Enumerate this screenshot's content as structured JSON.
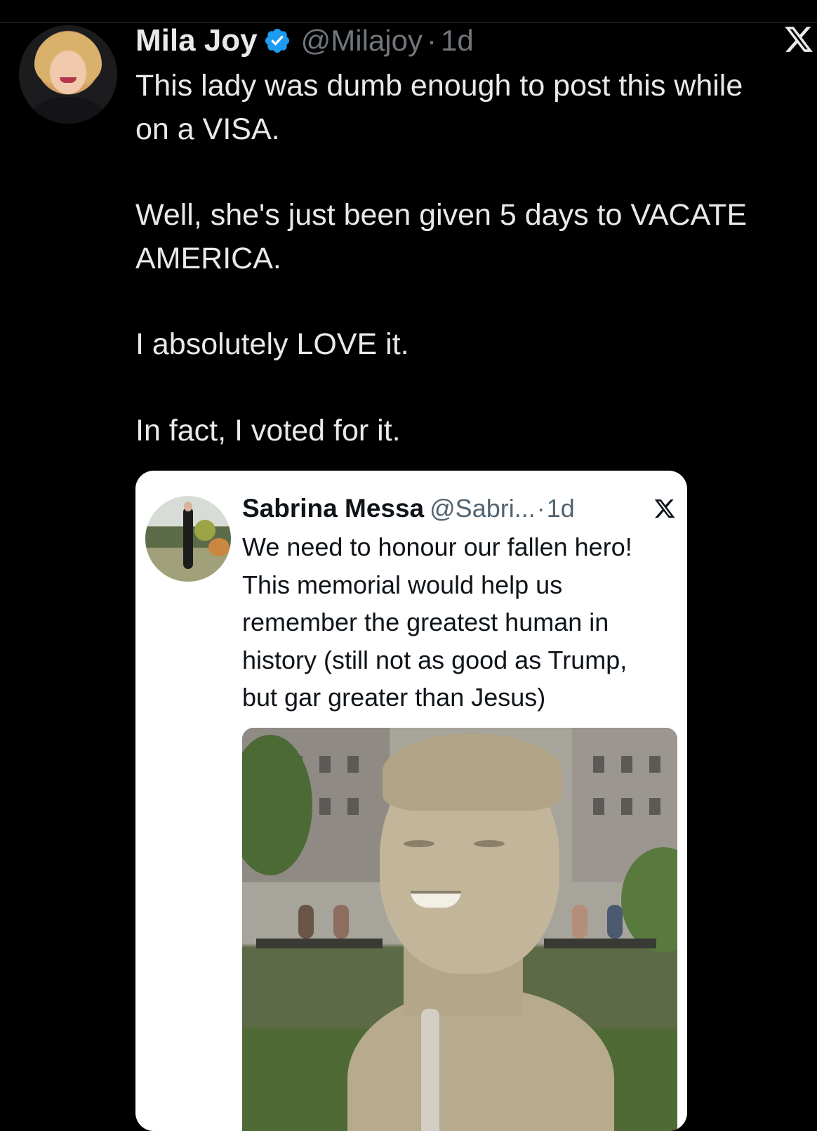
{
  "tweet": {
    "author_name": "Mila Joy",
    "handle": "@Milajoy",
    "separator": "·",
    "time": "1d",
    "text_paragraphs": [
      [
        "This lady was dumb enough to post this while",
        "on a VISA."
      ],
      [
        "Well, she's just been given 5 days to VACATE",
        "AMERICA."
      ],
      [
        "I absolutely LOVE it."
      ],
      [
        "In fact, I voted for it."
      ]
    ],
    "icons": {
      "verified": "verified-badge-icon",
      "platform": "x-logo-icon"
    },
    "colors": {
      "verified": "#1d9bf0",
      "background": "#000000",
      "text": "#e7e9ea",
      "muted": "#71767b"
    }
  },
  "quoted_tweet": {
    "author_name": "Sabrina Messa",
    "handle": "@Sabri...",
    "separator": "·",
    "time": "1d",
    "text_lines": [
      "We need to honour our fallen hero!",
      "This memorial would help us",
      "remember the greatest human in",
      "history (still not as good as Trump,",
      "but gar greater than Jesus)"
    ],
    "icons": {
      "platform": "x-logo-icon"
    },
    "colors": {
      "background": "#ffffff",
      "text": "#0f1419",
      "muted": "#536471"
    }
  }
}
